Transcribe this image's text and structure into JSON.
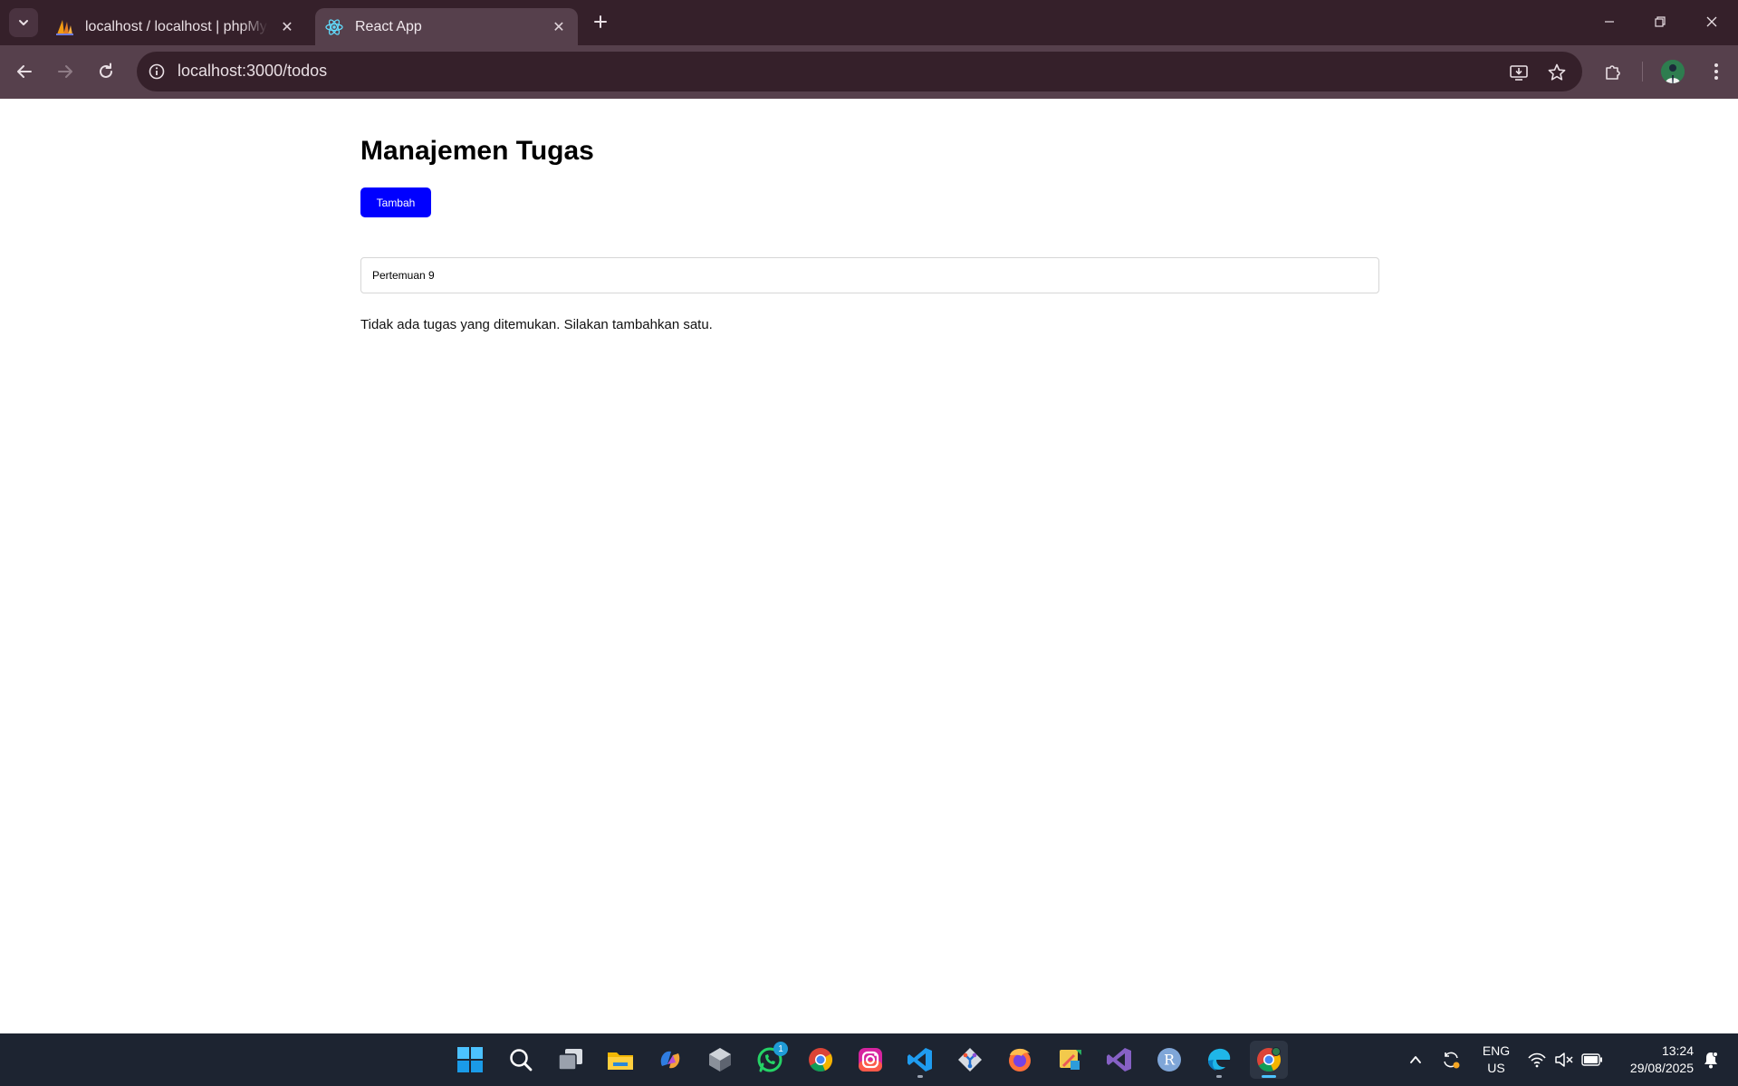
{
  "browser": {
    "tabs": [
      {
        "title": "localhost / localhost | phpMyAdmin",
        "active": false,
        "favicon": "phpmyadmin-sail-icon"
      },
      {
        "title": "React App",
        "active": true,
        "favicon": "react-atom-icon"
      }
    ],
    "address": "localhost:3000/todos"
  },
  "page": {
    "title": "Manajemen Tugas",
    "add_button": "Tambah",
    "input_value": "Pertemuan 9",
    "empty_message": "Tidak ada tugas yang ditemukan. Silakan tambahkan satu."
  },
  "taskbar": {
    "apps": [
      {
        "name": "start",
        "icon": "windows-start-icon"
      },
      {
        "name": "search",
        "icon": "search-icon"
      },
      {
        "name": "task-view",
        "icon": "task-view-icon"
      },
      {
        "name": "file-explorer",
        "icon": "folder-icon"
      },
      {
        "name": "copilot",
        "icon": "copilot-icon"
      },
      {
        "name": "unity",
        "icon": "unity-icon"
      },
      {
        "name": "whatsapp",
        "icon": "whatsapp-icon",
        "badge": "1"
      },
      {
        "name": "chrome",
        "icon": "chrome-icon"
      },
      {
        "name": "instagram",
        "icon": "instagram-icon"
      },
      {
        "name": "vscode",
        "icon": "vscode-icon"
      },
      {
        "name": "git",
        "icon": "git-icon"
      },
      {
        "name": "firefox",
        "icon": "firefox-icon"
      },
      {
        "name": "app-tool",
        "icon": "tool-icon"
      },
      {
        "name": "visual-studio",
        "icon": "visual-studio-icon"
      },
      {
        "name": "r-app",
        "icon": "r-icon"
      },
      {
        "name": "edge-app",
        "icon": "edge-icon"
      },
      {
        "name": "chrome-active",
        "icon": "chrome-icon"
      }
    ],
    "lang_line1": "ENG",
    "lang_line2": "US",
    "time": "13:24",
    "date": "29/08/2025"
  },
  "colors": {
    "tabbar": "#35202a",
    "toolbar": "#56404c",
    "add_button": "#0000ff",
    "taskbar": "#1d2431"
  }
}
